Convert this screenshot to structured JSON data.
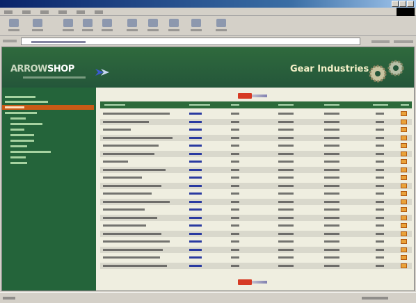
{
  "window": {
    "title": "",
    "menu": [],
    "toolbar_buttons": [],
    "address": "",
    "go_label": "",
    "links_label": ""
  },
  "site": {
    "brand_prefix": "ARROW",
    "brand_suffix": "SHOP",
    "brand_tagline": "",
    "page_heading": "Gear Industries"
  },
  "sidebar": {
    "items": []
  },
  "table": {
    "headers": [],
    "rows": []
  },
  "status": {
    "left": "",
    "zone": ""
  },
  "colors": {
    "banner_green": "#2f6a3d",
    "sidebar_green": "#24643a",
    "active_orange": "#c95a16",
    "pager_red": "#d63a24",
    "link_blue": "#2a3aa0",
    "cart_orange": "#e9a23a"
  },
  "icons": {
    "toolbar": [
      "back-icon",
      "forward-icon",
      "stop-icon",
      "refresh-icon",
      "home-icon",
      "search-icon",
      "favorites-icon",
      "history-icon",
      "mail-icon",
      "print-icon",
      "edit-icon"
    ],
    "row_action": "cart-icon",
    "zone": "internet-zone-icon"
  }
}
